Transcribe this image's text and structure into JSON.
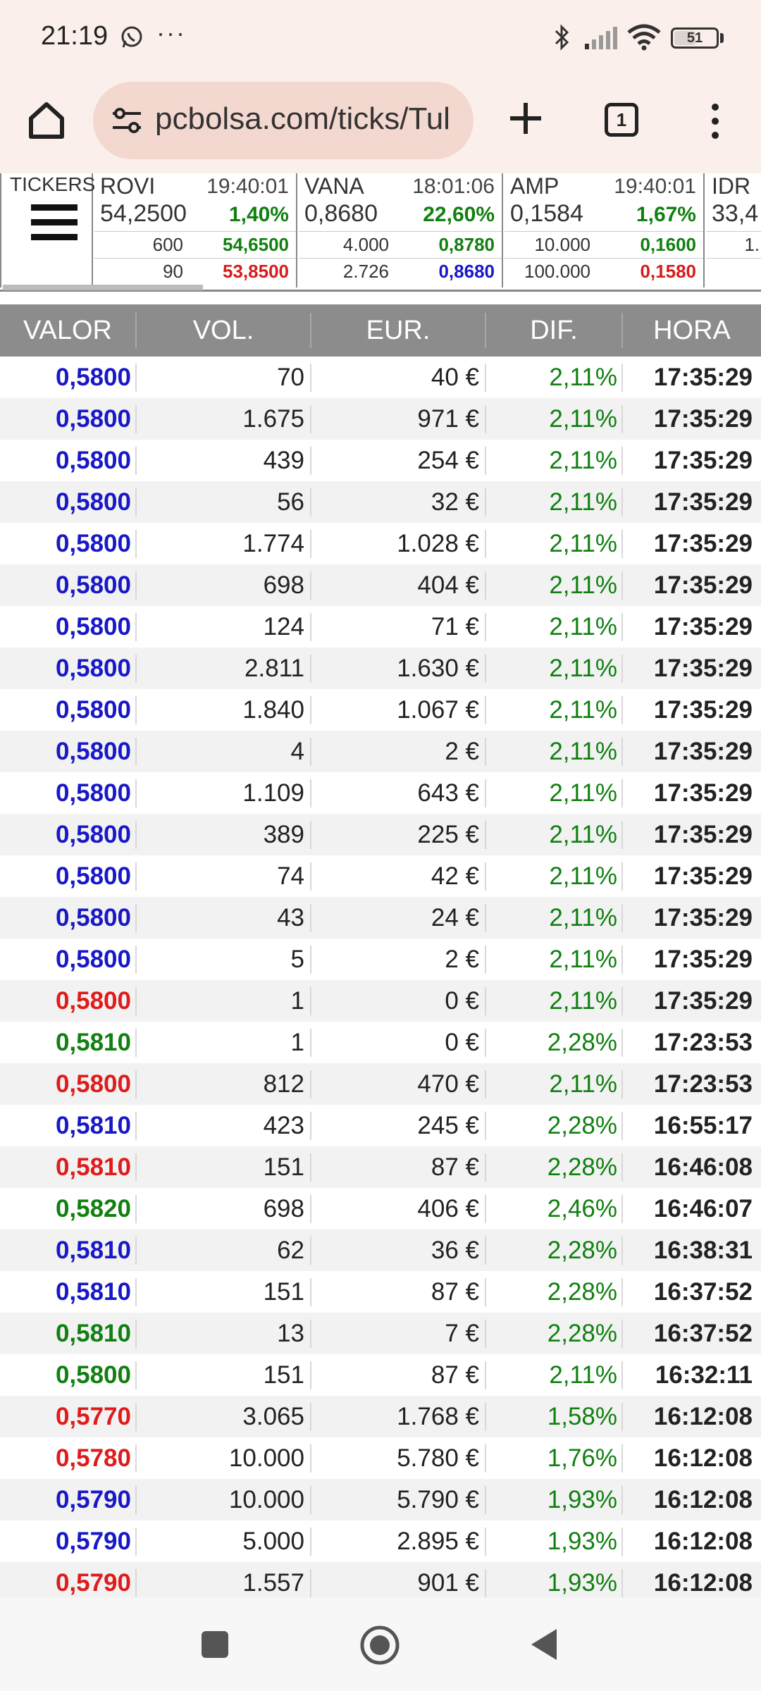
{
  "status_bar": {
    "time": "21:19",
    "dots": "···",
    "battery": "51"
  },
  "browser": {
    "url": "pcbolsa.com/ticks/Tul",
    "tab_count": "1"
  },
  "tickers_label": "TICKERS",
  "tickers": [
    {
      "name": "ROVI",
      "time": "19:40:01",
      "price": "54,2500",
      "pct": "1,40%",
      "vol1": "600",
      "high": "54,6500",
      "vol2": "90",
      "low": "53,8500",
      "low_color": "#d81b1b"
    },
    {
      "name": "VANA",
      "time": "18:01:06",
      "price": "0,8680",
      "pct": "22,60%",
      "vol1": "4.000",
      "high": "0,8780",
      "vol2": "2.726",
      "low": "0,8680",
      "low_color": "#1818c8"
    },
    {
      "name": "AMP",
      "time": "19:40:01",
      "price": "0,1584",
      "pct": "1,67%",
      "vol1": "10.000",
      "high": "0,1600",
      "vol2": "100.000",
      "low": "0,1580",
      "low_color": "#d81b1b"
    },
    {
      "name": "IDR",
      "time": "",
      "price": "33,4",
      "pct": "",
      "vol1": "1.",
      "high": "",
      "vol2": "",
      "low": "",
      "low_color": "#d81b1b"
    }
  ],
  "table": {
    "headers": [
      "VALOR",
      "VOL.",
      "EUR.",
      "DIF.",
      "HORA"
    ],
    "colors": {
      "blue": "#1818c8",
      "red": "#e01b1b",
      "green": "#118011"
    },
    "rows": [
      {
        "valor": "0,5800",
        "color": "blue",
        "vol": "70",
        "eur": "40 €",
        "dif": "2,11%",
        "hora": "17:35:29"
      },
      {
        "valor": "0,5800",
        "color": "blue",
        "vol": "1.675",
        "eur": "971 €",
        "dif": "2,11%",
        "hora": "17:35:29"
      },
      {
        "valor": "0,5800",
        "color": "blue",
        "vol": "439",
        "eur": "254 €",
        "dif": "2,11%",
        "hora": "17:35:29"
      },
      {
        "valor": "0,5800",
        "color": "blue",
        "vol": "56",
        "eur": "32 €",
        "dif": "2,11%",
        "hora": "17:35:29"
      },
      {
        "valor": "0,5800",
        "color": "blue",
        "vol": "1.774",
        "eur": "1.028 €",
        "dif": "2,11%",
        "hora": "17:35:29"
      },
      {
        "valor": "0,5800",
        "color": "blue",
        "vol": "698",
        "eur": "404 €",
        "dif": "2,11%",
        "hora": "17:35:29"
      },
      {
        "valor": "0,5800",
        "color": "blue",
        "vol": "124",
        "eur": "71 €",
        "dif": "2,11%",
        "hora": "17:35:29"
      },
      {
        "valor": "0,5800",
        "color": "blue",
        "vol": "2.811",
        "eur": "1.630 €",
        "dif": "2,11%",
        "hora": "17:35:29"
      },
      {
        "valor": "0,5800",
        "color": "blue",
        "vol": "1.840",
        "eur": "1.067 €",
        "dif": "2,11%",
        "hora": "17:35:29"
      },
      {
        "valor": "0,5800",
        "color": "blue",
        "vol": "4",
        "eur": "2 €",
        "dif": "2,11%",
        "hora": "17:35:29"
      },
      {
        "valor": "0,5800",
        "color": "blue",
        "vol": "1.109",
        "eur": "643 €",
        "dif": "2,11%",
        "hora": "17:35:29"
      },
      {
        "valor": "0,5800",
        "color": "blue",
        "vol": "389",
        "eur": "225 €",
        "dif": "2,11%",
        "hora": "17:35:29"
      },
      {
        "valor": "0,5800",
        "color": "blue",
        "vol": "74",
        "eur": "42 €",
        "dif": "2,11%",
        "hora": "17:35:29"
      },
      {
        "valor": "0,5800",
        "color": "blue",
        "vol": "43",
        "eur": "24 €",
        "dif": "2,11%",
        "hora": "17:35:29"
      },
      {
        "valor": "0,5800",
        "color": "blue",
        "vol": "5",
        "eur": "2 €",
        "dif": "2,11%",
        "hora": "17:35:29"
      },
      {
        "valor": "0,5800",
        "color": "red",
        "vol": "1",
        "eur": "0 €",
        "dif": "2,11%",
        "hora": "17:35:29"
      },
      {
        "valor": "0,5810",
        "color": "green",
        "vol": "1",
        "eur": "0 €",
        "dif": "2,28%",
        "hora": "17:23:53"
      },
      {
        "valor": "0,5800",
        "color": "red",
        "vol": "812",
        "eur": "470 €",
        "dif": "2,11%",
        "hora": "17:23:53"
      },
      {
        "valor": "0,5810",
        "color": "blue",
        "vol": "423",
        "eur": "245 €",
        "dif": "2,28%",
        "hora": "16:55:17"
      },
      {
        "valor": "0,5810",
        "color": "red",
        "vol": "151",
        "eur": "87 €",
        "dif": "2,28%",
        "hora": "16:46:08"
      },
      {
        "valor": "0,5820",
        "color": "green",
        "vol": "698",
        "eur": "406 €",
        "dif": "2,46%",
        "hora": "16:46:07"
      },
      {
        "valor": "0,5810",
        "color": "blue",
        "vol": "62",
        "eur": "36 €",
        "dif": "2,28%",
        "hora": "16:38:31"
      },
      {
        "valor": "0,5810",
        "color": "blue",
        "vol": "151",
        "eur": "87 €",
        "dif": "2,28%",
        "hora": "16:37:52"
      },
      {
        "valor": "0,5810",
        "color": "green",
        "vol": "13",
        "eur": "7 €",
        "dif": "2,28%",
        "hora": "16:37:52"
      },
      {
        "valor": "0,5800",
        "color": "green",
        "vol": "151",
        "eur": "87 €",
        "dif": "2,11%",
        "hora": "16:32:11"
      },
      {
        "valor": "0,5770",
        "color": "red",
        "vol": "3.065",
        "eur": "1.768 €",
        "dif": "1,58%",
        "hora": "16:12:08"
      },
      {
        "valor": "0,5780",
        "color": "red",
        "vol": "10.000",
        "eur": "5.780 €",
        "dif": "1,76%",
        "hora": "16:12:08"
      },
      {
        "valor": "0,5790",
        "color": "blue",
        "vol": "10.000",
        "eur": "5.790 €",
        "dif": "1,93%",
        "hora": "16:12:08"
      },
      {
        "valor": "0,5790",
        "color": "blue",
        "vol": "5.000",
        "eur": "2.895 €",
        "dif": "1,93%",
        "hora": "16:12:08"
      },
      {
        "valor": "0,5790",
        "color": "red",
        "vol": "1.557",
        "eur": "901 €",
        "dif": "1,93%",
        "hora": "16:12:08"
      }
    ]
  }
}
